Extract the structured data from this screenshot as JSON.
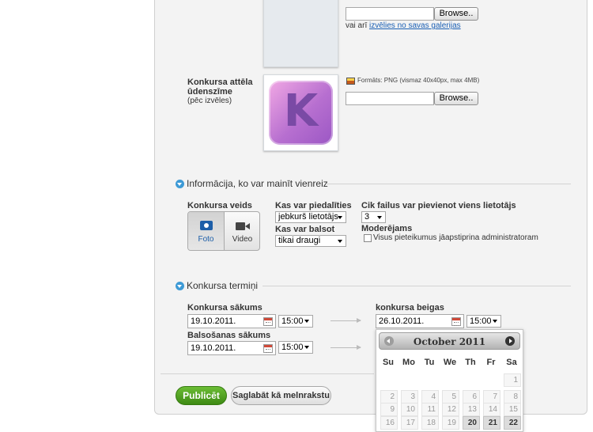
{
  "colors": {
    "primary_button": "#4fa323",
    "section_icon": "#3d9ad6",
    "link": "#1a5fb4"
  },
  "upload1": {
    "browse_label": "Browse..",
    "alt_text_prefix": "vai arī ",
    "alt_link": "izvēlies no savas galerijas"
  },
  "watermark": {
    "label_line1": "Konkursa attēla",
    "label_line2": "ūdenszīme",
    "label_optional": "(pēc izvēles)",
    "image_letter": "K",
    "format_text": "Formāts: PNG (vismaz 40x40px, max 4MB)",
    "browse_label": "Browse.."
  },
  "section_info": {
    "title": "Informācija, ko var mainīt vienreiz",
    "type_label": "Konkursa veids",
    "type_photo": "Foto",
    "type_video": "Video",
    "participate_label": "Kas var piedalīties",
    "participate_value": "jebkurš lietotājs",
    "vote_label": "Kas var balsot",
    "vote_value": "tikai draugi",
    "files_label": "Cik failus var pievienot viens lietotājs",
    "files_value": "3",
    "moderated_label": "Moderējams",
    "moderated_checkbox_label": "Visus pieteikumus jāapstiprina administratoram"
  },
  "section_dates": {
    "title": "Konkursa termiņi",
    "start_label": "Konkursa sākums",
    "start_date": "19.10.2011.",
    "start_time": "15:00",
    "end_label": "konkursa beigas",
    "end_date": "26.10.2011.",
    "end_time": "15:00",
    "vote_start_label": "Balsošanas sākums",
    "vote_start_date": "19.10.2011.",
    "vote_start_time": "15:00"
  },
  "calendar": {
    "title": "October 2011",
    "weekdays": [
      "Su",
      "Mo",
      "Tu",
      "We",
      "Th",
      "Fr",
      "Sa"
    ],
    "row1": [
      "",
      "",
      "",
      "",
      "",
      "",
      "1"
    ],
    "row2": [
      "2",
      "3",
      "4",
      "5",
      "6",
      "7",
      "8"
    ],
    "row3": [
      "9",
      "10",
      "11",
      "12",
      "13",
      "14",
      "15"
    ],
    "row4": [
      "16",
      "17",
      "18",
      "19",
      "20",
      "21",
      "22"
    ]
  },
  "buttons": {
    "publish": "Publicēt",
    "save_draft": "Saglabāt kā melnrakstu"
  }
}
